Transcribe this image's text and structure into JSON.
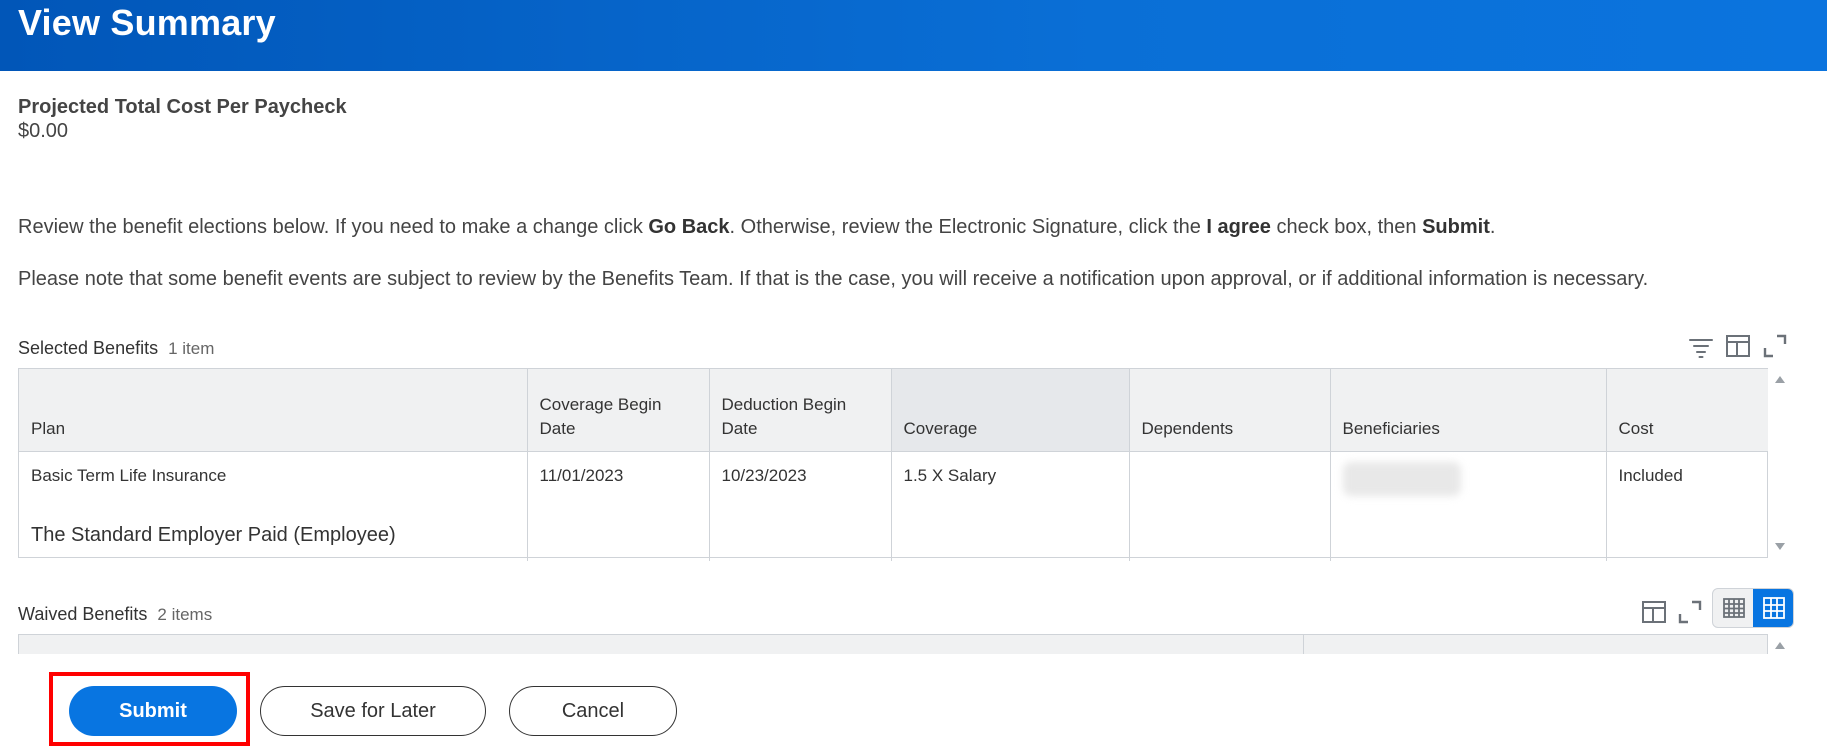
{
  "header": {
    "title": "View Summary"
  },
  "projected": {
    "label": "Projected Total Cost Per Paycheck",
    "value": "$0.00"
  },
  "instructions": {
    "p1_a": "Review the benefit elections below.  If you need to make a change click ",
    "p1_go_back": "Go Back",
    "p1_b": ".  Otherwise, review the Electronic Signature,  click the ",
    "p1_agree": "I agree",
    "p1_c": " check box, then ",
    "p1_submit": "Submit",
    "p1_d": ".",
    "p2": "Please note that some benefit events are subject to review by the Benefits Team.  If that is the case, you will receive a notification upon approval, or if additional information is necessary."
  },
  "selected_benefits": {
    "title": "Selected Benefits",
    "count": "1 item",
    "columns": {
      "plan": "Plan",
      "coverage_begin": "Coverage Begin Date",
      "deduction_begin": "Deduction Begin Date",
      "coverage": "Coverage",
      "dependents": "Dependents",
      "beneficiaries": "Beneficiaries",
      "cost": "Cost"
    },
    "rows": [
      {
        "plan": "Basic Term Life Insurance",
        "plan_sub": "The Standard Employer Paid (Employee)",
        "coverage_begin": "11/01/2023",
        "deduction_begin": "10/23/2023",
        "coverage": "1.5 X Salary",
        "dependents": "",
        "cost": "Included"
      }
    ]
  },
  "waived_benefits": {
    "title": "Waived Benefits",
    "count": "2 items"
  },
  "buttons": {
    "submit": "Submit",
    "save_for_later": "Save for Later",
    "cancel": "Cancel"
  },
  "colors": {
    "primary": "#0875e1",
    "header": "#0a6fd6",
    "highlight": "#ff0000"
  },
  "icons": [
    "filter-icon",
    "column-layout-icon",
    "expand-icon",
    "table-view-icon",
    "grid-view-icon"
  ]
}
